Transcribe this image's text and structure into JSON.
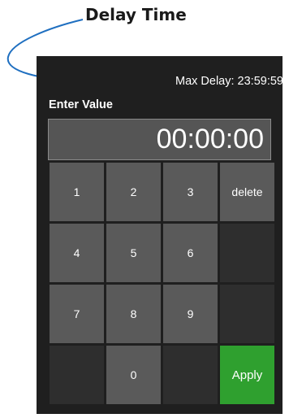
{
  "annotation": {
    "callout_text": "Delay Time"
  },
  "keypad_panel": {
    "max_delay": "Max Delay: 23:59:59",
    "enter_label": "Enter Value",
    "display_value": "00:00:00",
    "keys": {
      "k1": "1",
      "k2": "2",
      "k3": "3",
      "delete": "delete",
      "k4": "4",
      "k5": "5",
      "k6": "6",
      "k7": "7",
      "k8": "8",
      "k9": "9",
      "k0": "0",
      "apply": "Apply"
    }
  },
  "colors": {
    "panel_background": "#1f1f1f",
    "key_background": "#5a5a5a",
    "blank_key_background": "#2e2e2e",
    "apply_button": "#2fa02f",
    "callout_arrow": "#1f6fc0"
  }
}
